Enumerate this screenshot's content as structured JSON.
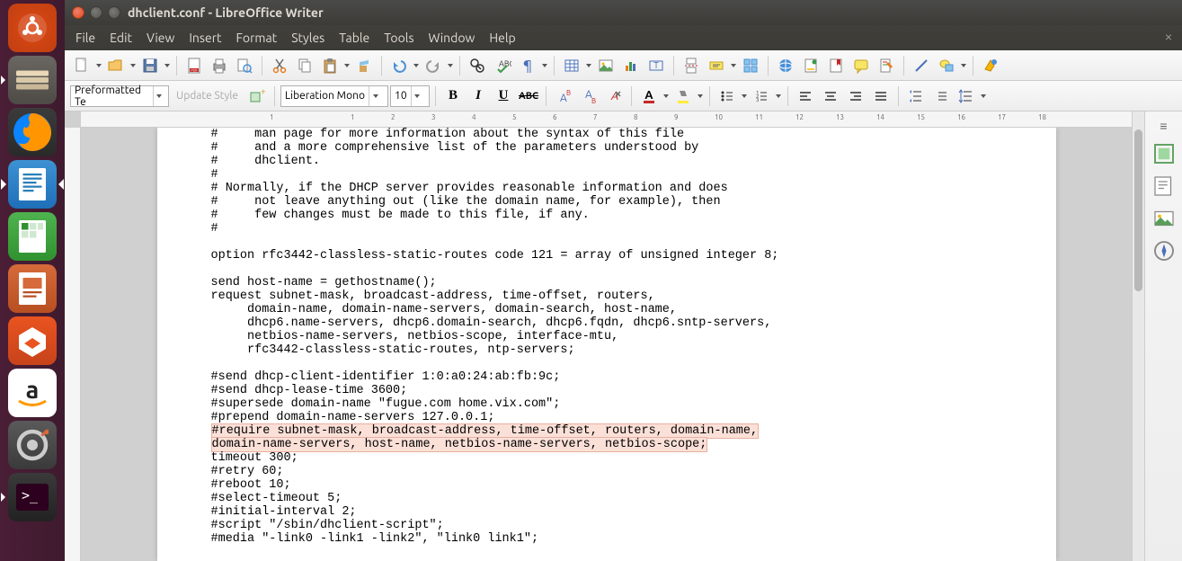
{
  "launcher": {
    "items": [
      {
        "name": "ubuntu-dash",
        "tooltip": "Dash"
      },
      {
        "name": "files",
        "tooltip": "Files"
      },
      {
        "name": "firefox",
        "tooltip": "Firefox"
      },
      {
        "name": "libreoffice-writer",
        "tooltip": "LibreOffice Writer"
      },
      {
        "name": "libreoffice-calc",
        "tooltip": "LibreOffice Calc"
      },
      {
        "name": "libreoffice-impress",
        "tooltip": "LibreOffice Impress"
      },
      {
        "name": "ubuntu-software",
        "tooltip": "Ubuntu Software"
      },
      {
        "name": "amazon",
        "tooltip": "Amazon"
      },
      {
        "name": "system-settings",
        "tooltip": "System Settings"
      },
      {
        "name": "terminal",
        "tooltip": "Terminal"
      }
    ]
  },
  "window": {
    "title": "dhclient.conf - LibreOffice Writer"
  },
  "menu": {
    "items": [
      "File",
      "Edit",
      "View",
      "Insert",
      "Format",
      "Styles",
      "Table",
      "Tools",
      "Window",
      "Help"
    ]
  },
  "formatting": {
    "paragraph_style": "Preformatted Te",
    "update_style_label": "Update Style",
    "font_name": "Liberation Mono",
    "font_size": "10"
  },
  "ruler": {
    "ticks": [
      "1",
      "",
      "1",
      "2",
      "3",
      "4",
      "5",
      "6",
      "7",
      "8",
      "9",
      "10",
      "11",
      "12",
      "13",
      "14",
      "15",
      "16",
      "17",
      "18"
    ]
  },
  "document": {
    "lines_before": [
      "#     man page for more information about the syntax of this file",
      "#     and a more comprehensive list of the parameters understood by",
      "#     dhclient.",
      "#",
      "# Normally, if the DHCP server provides reasonable information and does",
      "#     not leave anything out (like the domain name, for example), then",
      "#     few changes must be made to this file, if any.",
      "#",
      "",
      "option rfc3442-classless-static-routes code 121 = array of unsigned integer 8;",
      "",
      "send host-name = gethostname();",
      "request subnet-mask, broadcast-address, time-offset, routers,",
      "     domain-name, domain-name-servers, domain-search, host-name,",
      "     dhcp6.name-servers, dhcp6.domain-search, dhcp6.fqdn, dhcp6.sntp-servers,",
      "     netbios-name-servers, netbios-scope, interface-mtu,",
      "     rfc3442-classless-static-routes, ntp-servers;",
      "",
      "#send dhcp-client-identifier 1:0:a0:24:ab:fb:9c;",
      "#send dhcp-lease-time 3600;",
      "#supersede domain-name \"fugue.com home.vix.com\";",
      "#prepend domain-name-servers 127.0.0.1;"
    ],
    "highlighted_line1": "#require subnet-mask, broadcast-address, time-offset, routers, domain-name,",
    "highlighted_line2": "domain-name-servers, host-name, netbios-name-servers, netbios-scope;",
    "lines_after": [
      "timeout 300;",
      "#retry 60;",
      "#reboot 10;",
      "#select-timeout 5;",
      "#initial-interval 2;",
      "#script \"/sbin/dhclient-script\";",
      "#media \"-link0 -link1 -link2\", \"link0 link1\";"
    ]
  }
}
